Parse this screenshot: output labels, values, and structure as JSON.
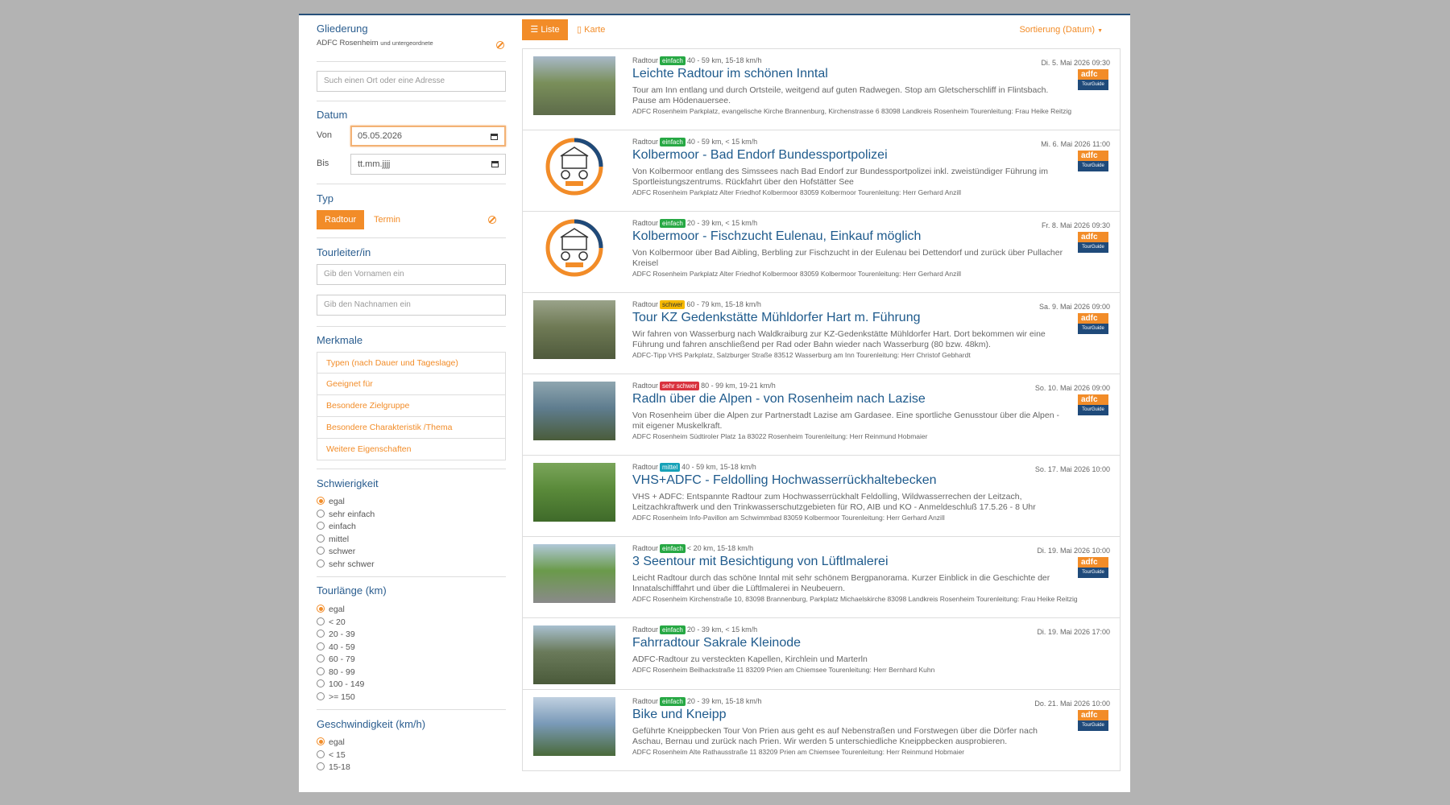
{
  "sidebar": {
    "gliederung": {
      "title": "Gliederung",
      "org": "ADFC Rosenheim",
      "org_sub": "und untergeordnete"
    },
    "search": {
      "placeholder": "Such einen Ort oder eine Adresse"
    },
    "datum": {
      "title": "Datum",
      "from_label": "Von",
      "from_value": "05.05.2026",
      "to_label": "Bis",
      "to_value": "tt.mm.jjjj"
    },
    "typ": {
      "title": "Typ",
      "options": [
        "Radtour",
        "Termin"
      ],
      "selected": "Radtour"
    },
    "tourleiter": {
      "title": "Tourleiter/in",
      "first_placeholder": "Gib den Vornamen ein",
      "last_placeholder": "Gib den Nachnamen ein"
    },
    "merkmale": {
      "title": "Merkmale",
      "items": [
        "Typen (nach Dauer und Tageslage)",
        "Geeignet für",
        "Besondere Zielgruppe",
        "Besondere Charakteristik /Thema",
        "Weitere Eigenschaften"
      ]
    },
    "schwierigkeit": {
      "title": "Schwierigkeit",
      "options": [
        "egal",
        "sehr einfach",
        "einfach",
        "mittel",
        "schwer",
        "sehr schwer"
      ],
      "selected": "egal"
    },
    "tourlaenge": {
      "title": "Tourlänge (km)",
      "options": [
        "egal",
        "< 20",
        "20 - 39",
        "40 - 59",
        "60 - 79",
        "80 - 99",
        "100 - 149",
        ">= 150"
      ],
      "selected": "egal"
    },
    "geschwindigkeit": {
      "title": "Geschwindigkeit (km/h)",
      "options": [
        "egal",
        "< 15",
        "15-18"
      ],
      "selected": "egal"
    }
  },
  "toolbar": {
    "liste": "Liste",
    "karte": "Karte",
    "sort": "Sortierung (Datum)"
  },
  "colors": {
    "accent": "#f28c28",
    "link": "#1e5a8c",
    "einfach": "#27a844",
    "schwer": "#f5b800",
    "sehr_schwer": "#d9333f",
    "mittel": "#17a2b8"
  },
  "tours": [
    {
      "type": "Radtour",
      "level": "einfach",
      "level_color": "#27a844",
      "stats": "40 - 59 km, 15-18 km/h",
      "date": "Di. 5. Mai 2026 09:30",
      "title": "Leichte Radtour im schönen Inntal",
      "desc": "Tour am Inn entlang und durch Ortsteile, weitgend auf guten Radwegen. Stop am Gletscherschliff in Flintsbach. Pause am Hödenauersee.",
      "location": "ADFC Rosenheim Parkplatz, evangelische Kirche Brannenburg, Kirchenstrasse 6 83098 Landkreis Rosenheim Tourenleitung: Frau Heike Reitzig",
      "thumb": "photo",
      "adfc": true
    },
    {
      "type": "Radtour",
      "level": "einfach",
      "level_color": "#27a844",
      "stats": "40 - 59 km, < 15 km/h",
      "date": "Mi. 6. Mai 2026 11:00",
      "title": "Kolbermoor - Bad Endorf Bundessportpolizei",
      "desc": "Von Kolbermoor entlang des Simssees nach Bad Endorf zur Bundessportpolizei inkl. zweistündiger Führung im Sportleistungszentrums. Rückfahrt über den Hofstätter See",
      "location": "ADFC Rosenheim Parkplatz Alter Friedhof Kolbermoor 83059 Kolbermoor Tourenleitung: Herr Gerhard Anzill",
      "thumb": "logo",
      "adfc": true
    },
    {
      "type": "Radtour",
      "level": "einfach",
      "level_color": "#27a844",
      "stats": "20 - 39 km, < 15 km/h",
      "date": "Fr. 8. Mai 2026 09:30",
      "title": "Kolbermoor - Fischzucht Eulenau, Einkauf möglich",
      "desc": "Von Kolbermoor über Bad Aibling, Berbling zur Fischzucht in der Eulenau bei Dettendorf und zurück über Pullacher Kreisel",
      "location": "ADFC Rosenheim Parkplatz Alter Friedhof Kolbermoor 83059 Kolbermoor Tourenleitung: Herr Gerhard Anzill",
      "thumb": "logo",
      "adfc": true
    },
    {
      "type": "Radtour",
      "level": "schwer",
      "level_color": "#f5b800",
      "stats": "60 - 79 km, 15-18 km/h",
      "date": "Sa. 9. Mai 2026 09:00",
      "title": "Tour KZ Gedenkstätte Mühldorfer Hart m. Führung",
      "desc": "Wir fahren von Wasserburg nach Waldkraiburg zur KZ-Gedenkstätte Mühldorfer Hart. Dort bekommen wir eine Führung und fahren anschließend per Rad oder Bahn wieder nach Wasserburg (80 bzw. 48km).",
      "location": "ADFC-Tipp VHS Parkplatz, Salzburger Straße 83512 Wasserburg am Inn Tourenleitung: Herr Christof Gebhardt",
      "thumb": "photo",
      "adfc": true
    },
    {
      "type": "Radtour",
      "level": "sehr schwer",
      "level_color": "#d9333f",
      "stats": "80 - 99 km, 19-21 km/h",
      "date": "So. 10. Mai 2026 09:00",
      "title": "Radln über die Alpen - von Rosenheim nach Lazise",
      "desc": "Von Rosenheim über die Alpen zur Partnerstadt Lazise am Gardasee. Eine sportliche Genusstour über die Alpen - mit eigener Muskelkraft.",
      "location": "ADFC Rosenheim Südtiroler Platz 1a 83022 Rosenheim Tourenleitung: Herr Reinmund Hobmaier",
      "thumb": "photo",
      "adfc": true
    },
    {
      "type": "Radtour",
      "level": "mittel",
      "level_color": "#17a2b8",
      "stats": "40 - 59 km, 15-18 km/h",
      "date": "So. 17. Mai 2026 10:00",
      "title": "VHS+ADFC - Feldolling Hochwasserrückhaltebecken",
      "desc": "VHS + ADFC: Entspannte Radtour zum Hochwasserrückhalt Feldolling, Wildwasserrechen der Leitzach, Leitzachkraftwerk und den Trinkwasserschutzgebieten für RO, AIB und KO - Anmeldeschluß 17.5.26 - 8 Uhr",
      "location": "ADFC Rosenheim Info-Pavillon am Schwimmbad 83059 Kolbermoor Tourenleitung: Herr Gerhard Anzill",
      "thumb": "photo",
      "adfc": false
    },
    {
      "type": "Radtour",
      "level": "einfach",
      "level_color": "#27a844",
      "stats": "< 20 km, 15-18 km/h",
      "date": "Di. 19. Mai 2026 10:00",
      "title": "3 Seentour mit Besichtigung von Lüftlmalerei",
      "desc": "Leicht Radtour durch das schöne Inntal mit sehr schönem Bergpanorama. Kurzer Einblick in die Geschichte der Innatalschifffahrt und über die Lüftlmalerei in Neubeuern.",
      "location": "ADFC Rosenheim Kirchenstraße 10, 83098 Brannenburg, Parkplatz Michaelskirche 83098 Landkreis Rosenheim Tourenleitung: Frau Heike Reitzig",
      "thumb": "photo",
      "adfc": true
    },
    {
      "type": "Radtour",
      "level": "einfach",
      "level_color": "#27a844",
      "stats": "20 - 39 km, < 15 km/h",
      "date": "Di. 19. Mai 2026 17:00",
      "title": "Fahrradtour Sakrale Kleinode",
      "desc": "ADFC-Radtour zu versteckten Kapellen, Kirchlein und Marterln",
      "location": "ADFC Rosenheim Beilhackstraße 11 83209 Prien am Chiemsee Tourenleitung: Herr Bernhard Kuhn",
      "thumb": "photo",
      "adfc": false
    },
    {
      "type": "Radtour",
      "level": "einfach",
      "level_color": "#27a844",
      "stats": "20 - 39 km, 15-18 km/h",
      "date": "Do. 21. Mai 2026 10:00",
      "title": "Bike und Kneipp",
      "desc": "Geführte Kneippbecken Tour Von Prien aus geht es auf Nebenstraßen und Forstwegen über die Dörfer nach Aschau, Bernau und zurück nach Prien. Wir werden 5 unterschiedliche Kneippbecken ausprobieren.",
      "location": "ADFC Rosenheim Alte Rathausstraße 11 83209 Prien am Chiemsee Tourenleitung: Herr Reinmund Hobmaier",
      "thumb": "photo",
      "adfc": true
    }
  ],
  "adfc_logo": {
    "top": "adfc",
    "bottom": "TourGuide"
  }
}
